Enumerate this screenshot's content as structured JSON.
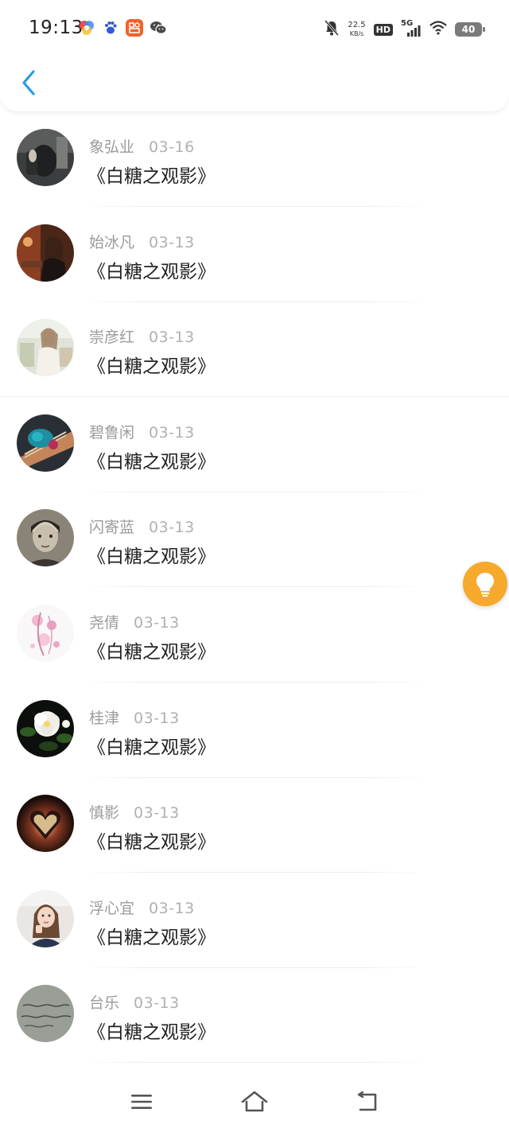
{
  "status_bar": {
    "time": "19:13",
    "net_speed_value": "22.5",
    "net_speed_unit": "KB/s",
    "hd_label": "HD",
    "network_label": "5G",
    "battery_level": "40",
    "app_icons": [
      "colorful-app-icon",
      "baidu-paw-icon",
      "orange-app-icon",
      "wechat-icon"
    ],
    "status_icons": [
      "mute-bell-icon",
      "hd-icon",
      "signal-icon",
      "wifi-icon",
      "battery-icon"
    ]
  },
  "header": {
    "back_icon": "chevron-left-icon",
    "accent_color": "#2b9be8"
  },
  "list": {
    "items": [
      {
        "name": "象弘业",
        "date": "03-16",
        "title": "《白糖之观影》",
        "avatar": "dark-portrait"
      },
      {
        "name": "始冰凡",
        "date": "03-13",
        "title": "《白糖之观影》",
        "avatar": "warm-portrait"
      },
      {
        "name": "崇彦红",
        "date": "03-13",
        "title": "《白糖之观影》",
        "avatar": "light-portrait"
      },
      {
        "name": "碧鲁闲",
        "date": "03-13",
        "title": "《白糖之观影》",
        "avatar": "guitar-photo"
      },
      {
        "name": "闪寄蓝",
        "date": "03-13",
        "title": "《白糖之观影》",
        "avatar": "vintage-portrait"
      },
      {
        "name": "尧倩",
        "date": "03-13",
        "title": "《白糖之观影》",
        "avatar": "pink-illustration"
      },
      {
        "name": "桂津",
        "date": "03-13",
        "title": "《白糖之观影》",
        "avatar": "white-flower"
      },
      {
        "name": "慎影",
        "date": "03-13",
        "title": "《白糖之观影》",
        "avatar": "glowing-heart"
      },
      {
        "name": "浮心宜",
        "date": "03-13",
        "title": "《白糖之观影》",
        "avatar": "girl-portrait"
      },
      {
        "name": "台乐",
        "date": "03-13",
        "title": "《白糖之观影》",
        "avatar": "handwriting"
      }
    ]
  },
  "floating_button": {
    "icon": "lightbulb-icon",
    "color": "#f7a92b"
  },
  "bottom_nav": {
    "menu_icon": "menu-icon",
    "home_icon": "home-icon",
    "back_icon": "return-icon"
  },
  "colors": {
    "name_text": "#9b9b9b",
    "date_text": "#b0b0b0",
    "title_text": "#222222"
  }
}
